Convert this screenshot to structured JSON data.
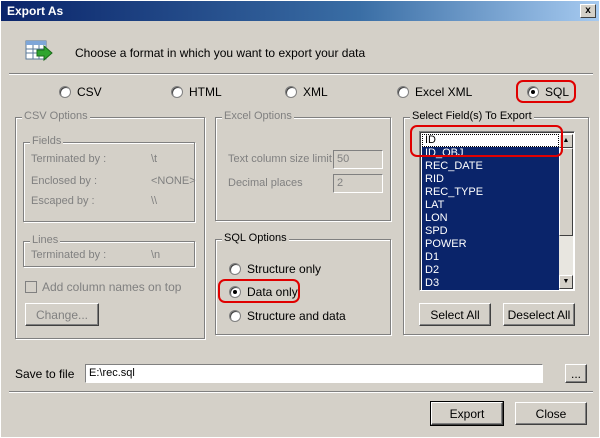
{
  "window": {
    "title": "Export As",
    "close_glyph": "x"
  },
  "header": {
    "text": "Choose a format in which you want to export your data",
    "icon": "export-table-icon"
  },
  "formats": [
    {
      "label": "CSV",
      "selected": false
    },
    {
      "label": "HTML",
      "selected": false
    },
    {
      "label": "XML",
      "selected": false
    },
    {
      "label": "Excel XML",
      "selected": false
    },
    {
      "label": "SQL",
      "selected": true
    }
  ],
  "csv_options": {
    "title": "CSV Options",
    "fields_title": "Fields",
    "terminated_label": "Terminated by :",
    "terminated_value": "\\t",
    "enclosed_label": "Enclosed by :",
    "enclosed_value": "<NONE>",
    "escaped_label": "Escaped by :",
    "escaped_value": "\\\\",
    "lines_title": "Lines",
    "lines_terminated_label": "Terminated by :",
    "lines_terminated_value": "\\n",
    "add_columns_label": "Add column names on top",
    "change_button": "Change..."
  },
  "excel_options": {
    "title": "Excel Options",
    "text_size_label": "Text column size limit",
    "text_size_value": "50",
    "decimal_label": "Decimal places",
    "decimal_value": "2"
  },
  "sql_options": {
    "title": "SQL Options",
    "options": [
      {
        "label": "Structure only",
        "selected": false
      },
      {
        "label": "Data only",
        "selected": true
      },
      {
        "label": "Structure and data",
        "selected": false
      }
    ]
  },
  "fields": {
    "title": "Select Field(s) To Export",
    "items": [
      "ID",
      "ID_OBJ",
      "REC_DATE",
      "RID",
      "REC_TYPE",
      "LAT",
      "LON",
      "SPD",
      "POWER",
      "D1",
      "D2",
      "D3"
    ],
    "select_all": "Select All",
    "deselect_all": "Deselect All"
  },
  "save": {
    "label": "Save to file",
    "value": "E:\\rec.sql",
    "browse": "..."
  },
  "buttons": {
    "export": "Export",
    "close": "Close"
  },
  "accent_color": "#e00000",
  "selection_color": "#0a246a"
}
